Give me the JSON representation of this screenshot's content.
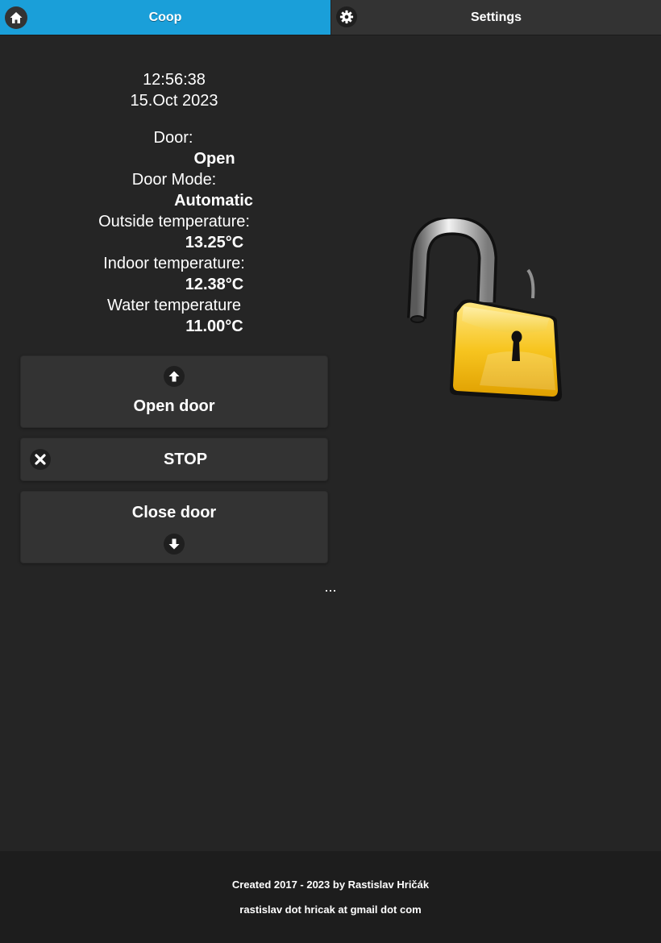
{
  "nav": {
    "tabs": [
      {
        "label": "Coop",
        "icon": "home-icon",
        "active": true
      },
      {
        "label": "Settings",
        "icon": "gear-icon",
        "active": false
      }
    ]
  },
  "status": {
    "time": "12:56:38",
    "date": "15.Oct 2023",
    "door_label": "Door:",
    "door_value": "Open",
    "mode_label": "Door Mode:",
    "mode_value": "Automatic",
    "outside_label": "Outside temperature:",
    "outside_value": "13.25°C",
    "indoor_label": "Indoor temperature:",
    "indoor_value": "12.38°C",
    "water_label": "Water temperature",
    "water_value": "11.00°C"
  },
  "buttons": {
    "open": {
      "label": "Open door",
      "icon": "arrow-up-icon"
    },
    "stop": {
      "label": "STOP",
      "icon": "close-icon"
    },
    "close": {
      "label": "Close door",
      "icon": "arrow-down-icon"
    }
  },
  "ellipsis": "...",
  "lock_image": {
    "icon": "open-padlock-icon",
    "state": "open"
  },
  "footer": {
    "line1": "Created 2017 - 2023 by Rastislav Hričák",
    "line2": "rastislav dot hricak at gmail dot com"
  },
  "colors": {
    "accent": "#1a9fd9",
    "background": "#252525",
    "bar": "#333333",
    "footer": "#1d1d1d",
    "lock_gold": "#f5c21b"
  }
}
